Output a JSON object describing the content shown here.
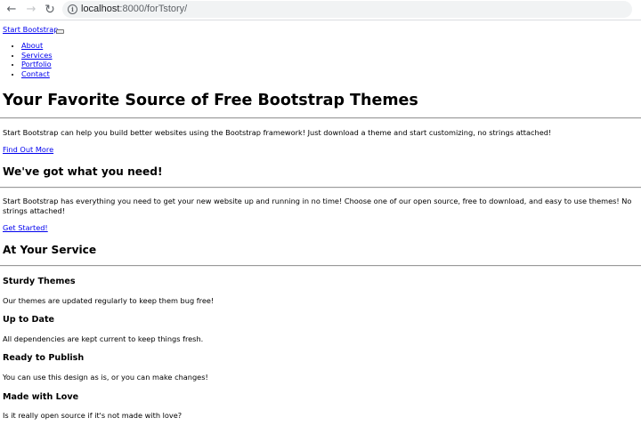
{
  "browser": {
    "back_icon": "←",
    "forward_icon": "→",
    "reload_icon": "↻",
    "info_icon": "i",
    "url_host": "localhost",
    "url_path": ":8000/forTstory/"
  },
  "navbar": {
    "brand": "Start Bootstrap",
    "items": [
      "About",
      "Services",
      "Portfolio",
      "Contact"
    ]
  },
  "masthead": {
    "heading": "Your Favorite Source of Free Bootstrap Themes",
    "text": "Start Bootstrap can help you build better websites using the Bootstrap framework! Just download a theme and start customizing, no strings attached!",
    "cta": "Find Out More"
  },
  "about": {
    "heading": "We've got what you need!",
    "text": "Start Bootstrap has everything you need to get your new website up and running in no time! Choose one of our open source, free to download, and easy to use themes! No strings attached!",
    "cta": "Get Started!"
  },
  "services": {
    "heading": "At Your Service",
    "items": [
      {
        "title": "Sturdy Themes",
        "text": "Our themes are updated regularly to keep them bug free!"
      },
      {
        "title": "Up to Date",
        "text": "All dependencies are kept current to keep things fresh."
      },
      {
        "title": "Ready to Publish",
        "text": "You can use this design as is, or you can make changes!"
      },
      {
        "title": "Made with Love",
        "text": "Is it really open source if it's not made with love?"
      }
    ]
  }
}
